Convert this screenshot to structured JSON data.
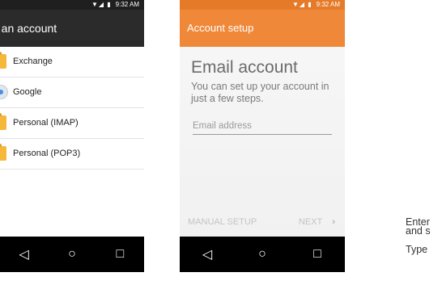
{
  "phone1": {
    "status": {
      "icons": "▼◢ ▮",
      "time": "9:32 AM"
    },
    "title": "d an account",
    "items": [
      {
        "label": "Exchange",
        "icon": "folder-icon"
      },
      {
        "label": "Google",
        "icon": "google-icon"
      },
      {
        "label": "Personal (IMAP)",
        "icon": "folder-icon"
      },
      {
        "label": "Personal (POP3)",
        "icon": "folder-icon"
      }
    ],
    "nav": {
      "back": "◁",
      "home": "○",
      "recents": "□"
    }
  },
  "phone2": {
    "status": {
      "icons": "▼◢ ▮",
      "time": "9:32 AM"
    },
    "title": "Account setup",
    "heading": "Email account",
    "description": "You can set up your account in just a few steps.",
    "email_placeholder": "Email address",
    "email_value": "",
    "manual_setup": "MANUAL SETUP",
    "next": "NEXT",
    "next_arrow": "›",
    "nav": {
      "back": "◁",
      "home": "○",
      "recents": "□"
    }
  },
  "caption": {
    "line1": "Enter",
    "line2": "and s",
    "line3": "Type"
  },
  "colors": {
    "orange_appbar": "#f0883a",
    "orange_status": "#e57b29",
    "dark_appbar": "#2b2b2b",
    "folder": "#f6b83b"
  }
}
